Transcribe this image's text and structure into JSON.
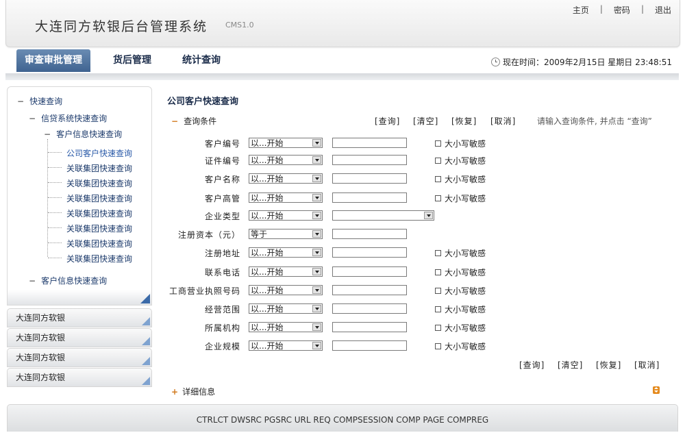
{
  "header": {
    "title": "大连同方软银后台管理系统",
    "version": "CMS1.0",
    "links": [
      "主页",
      "密码",
      "退出"
    ],
    "separator": "|"
  },
  "nav": {
    "tabs": [
      "审查审批管理",
      "货后管理",
      "统计查询"
    ],
    "active_tab": "审查审批管理",
    "time_text": "现在时间：2009年2月15日 星期日 23:48:51"
  },
  "sidebar": {
    "tree": {
      "root": "快速查询",
      "level1": "信贷系统快速查询",
      "level2": "客户信息快速查询",
      "leaves": [
        "公司客户快速查询",
        "关联集团快速查询",
        "关联集团快速查询",
        "关联集团快速查询",
        "关联集团快速查询",
        "关联集团快速查询",
        "关联集团快速查询",
        "关联集团快速查询"
      ],
      "selected_leaf": "公司客户快速查询",
      "sibling": "客户信息快速查询"
    },
    "groups": [
      "大连同方软银",
      "大连同方软银",
      "大连同方软银",
      "大连同方软银"
    ]
  },
  "main": {
    "heading": "公司客户快速查询",
    "section_label": "查询条件",
    "actions": [
      "[查询]",
      "[清空]",
      "[恢复]",
      "[取消]"
    ],
    "hint": "请输入查询条件, 并点击 “查询”",
    "case_label": "大小写敏感",
    "fields": [
      {
        "label": "客户编号",
        "operator": "以...开始",
        "case": true
      },
      {
        "label": "证件编号",
        "operator": "以...开始",
        "case": true
      },
      {
        "label": "客户名称",
        "operator": "以...开始",
        "case": true
      },
      {
        "label": "客户高管",
        "operator": "以...开始",
        "case": true
      },
      {
        "label": "企业类型",
        "operator": "以...开始",
        "case": false,
        "select": true
      },
      {
        "label": "注册资本（元）",
        "operator": "等于",
        "case": false
      },
      {
        "label": "注册地址",
        "operator": "以...开始",
        "case": true
      },
      {
        "label": "联系电话",
        "operator": "以...开始",
        "case": true
      },
      {
        "label": "工商营业执照号码",
        "operator": "以...开始",
        "case": true
      },
      {
        "label": "经营范围",
        "operator": "以...开始",
        "case": true
      },
      {
        "label": "所属机构",
        "operator": "以...开始",
        "case": true
      },
      {
        "label": "企业规模",
        "operator": "以...开始",
        "case": true
      }
    ],
    "detail_label": "详细信息"
  },
  "footer": {
    "text": "CTRLCT DWSRC PGSRC URL REQ COMPSESSION COMP PAGE COMPREG"
  }
}
